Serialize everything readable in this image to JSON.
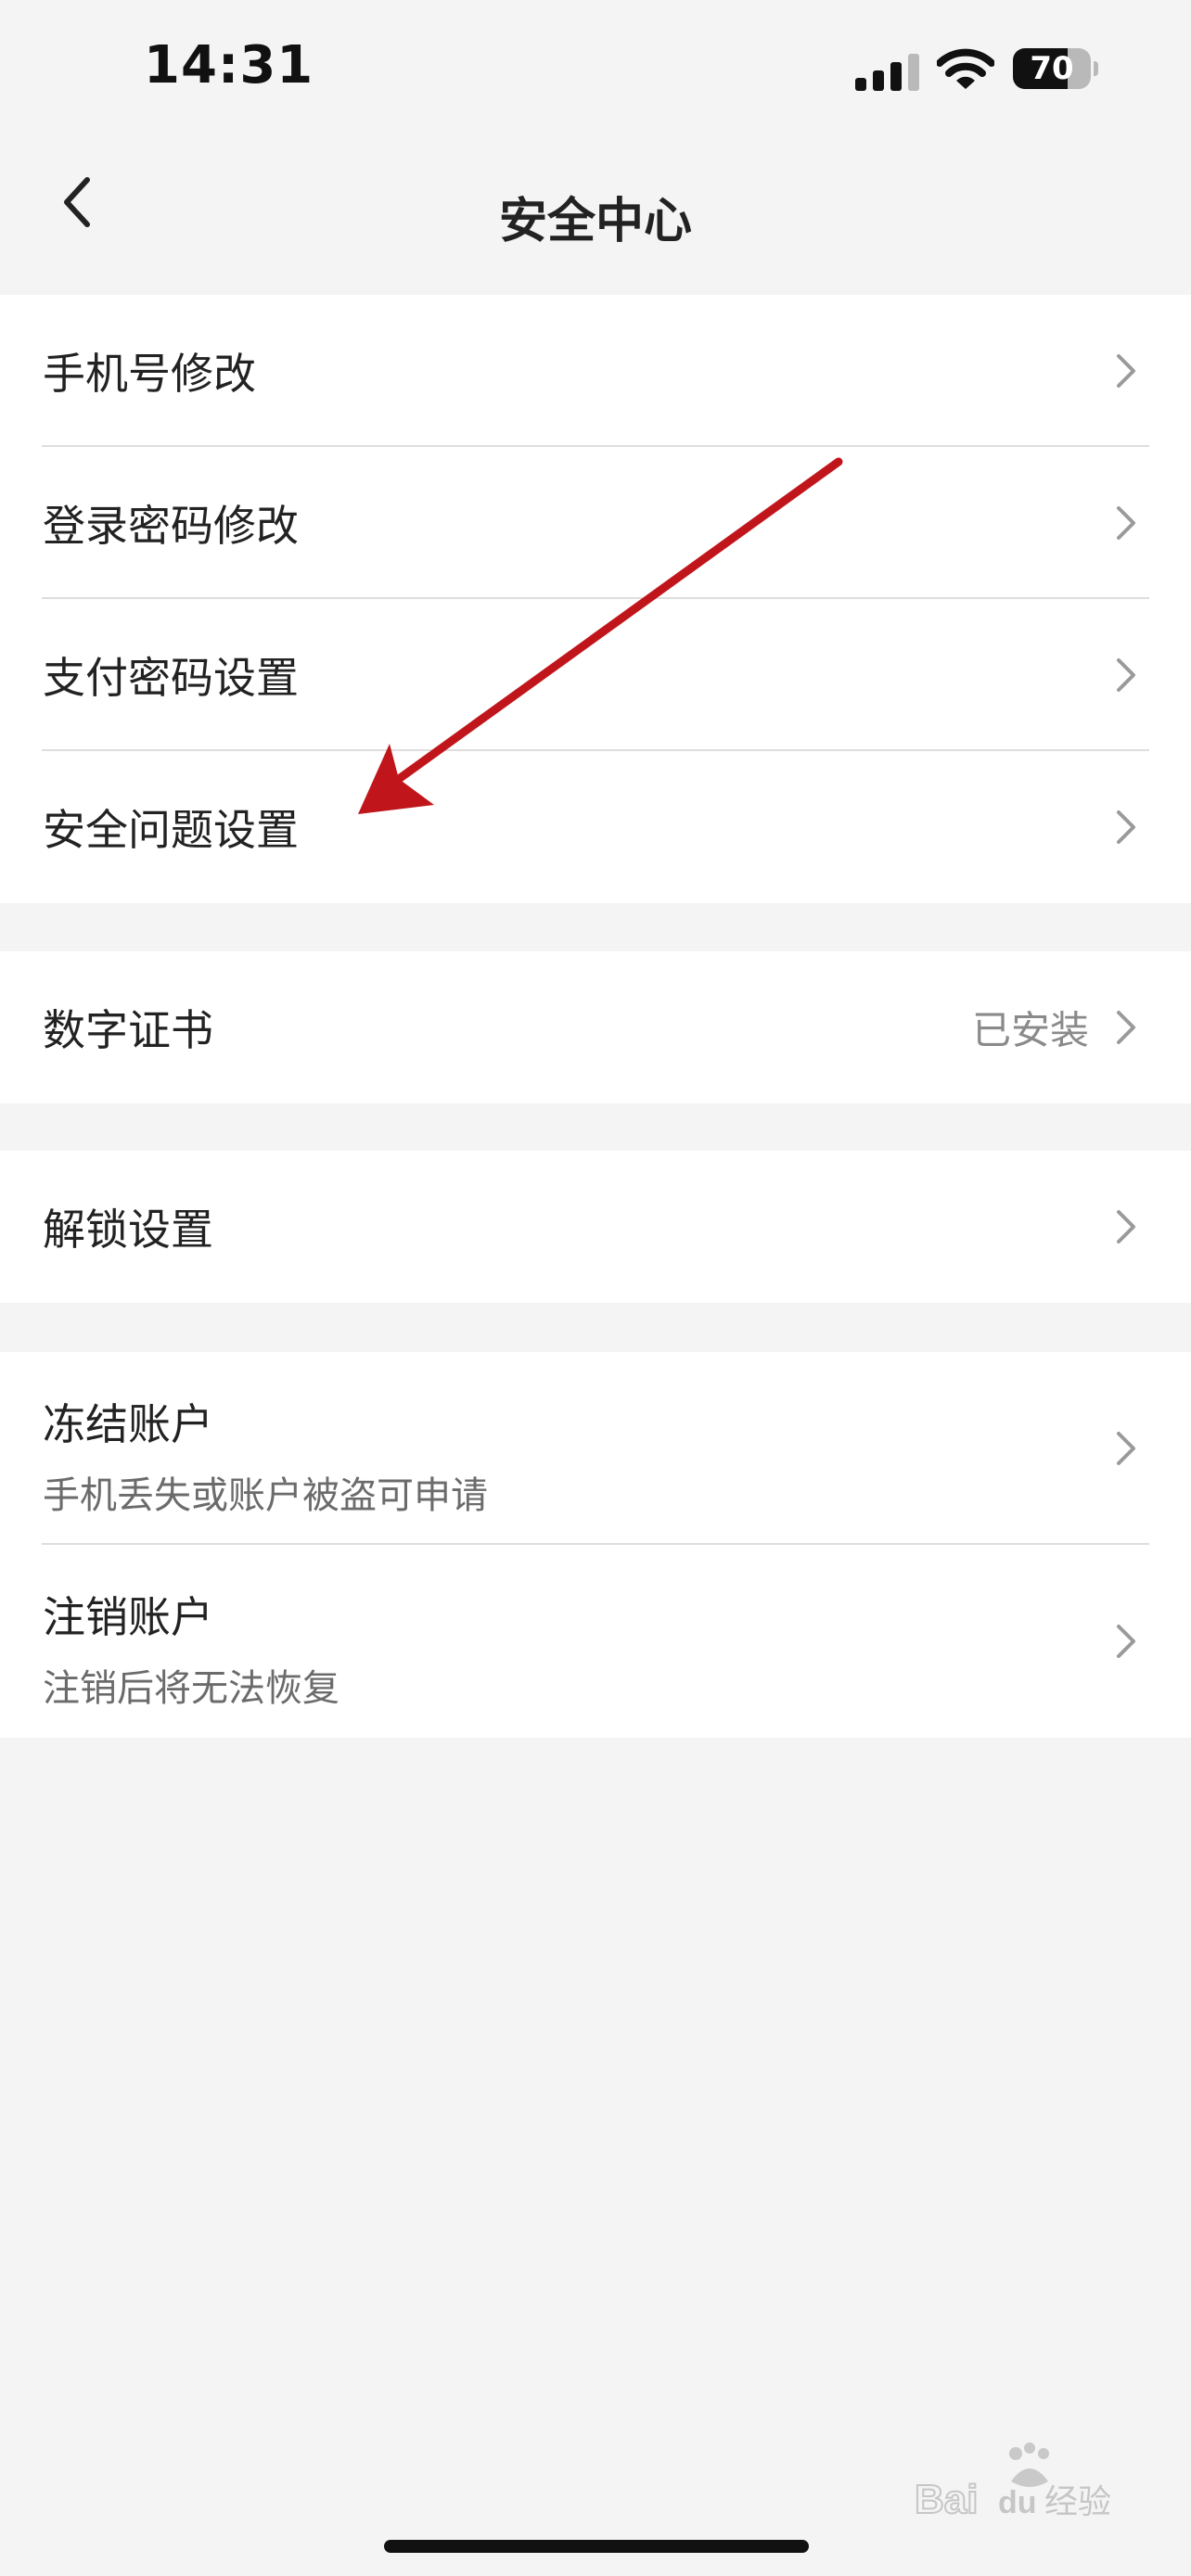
{
  "status_bar": {
    "time": "14:31",
    "battery_level": "70",
    "battery_fraction": 0.7
  },
  "header": {
    "title": "安全中心",
    "back_icon": "chevron-left-icon"
  },
  "groups": [
    {
      "items": [
        {
          "label": "手机号修改"
        },
        {
          "label": "登录密码修改"
        },
        {
          "label": "支付密码设置"
        },
        {
          "label": "安全问题设置"
        }
      ]
    },
    {
      "items": [
        {
          "label": "数字证书",
          "value": "已安装"
        }
      ]
    },
    {
      "items": [
        {
          "label": "解锁设置"
        }
      ]
    },
    {
      "items": [
        {
          "label": "冻结账户",
          "subtitle": "手机丢失或账户被盗可申请"
        },
        {
          "label": "注销账户",
          "subtitle": "注销后将无法恢复"
        }
      ]
    }
  ],
  "annotation": {
    "color": "#c0161b"
  },
  "watermark": {
    "text": "Baidu经验"
  }
}
